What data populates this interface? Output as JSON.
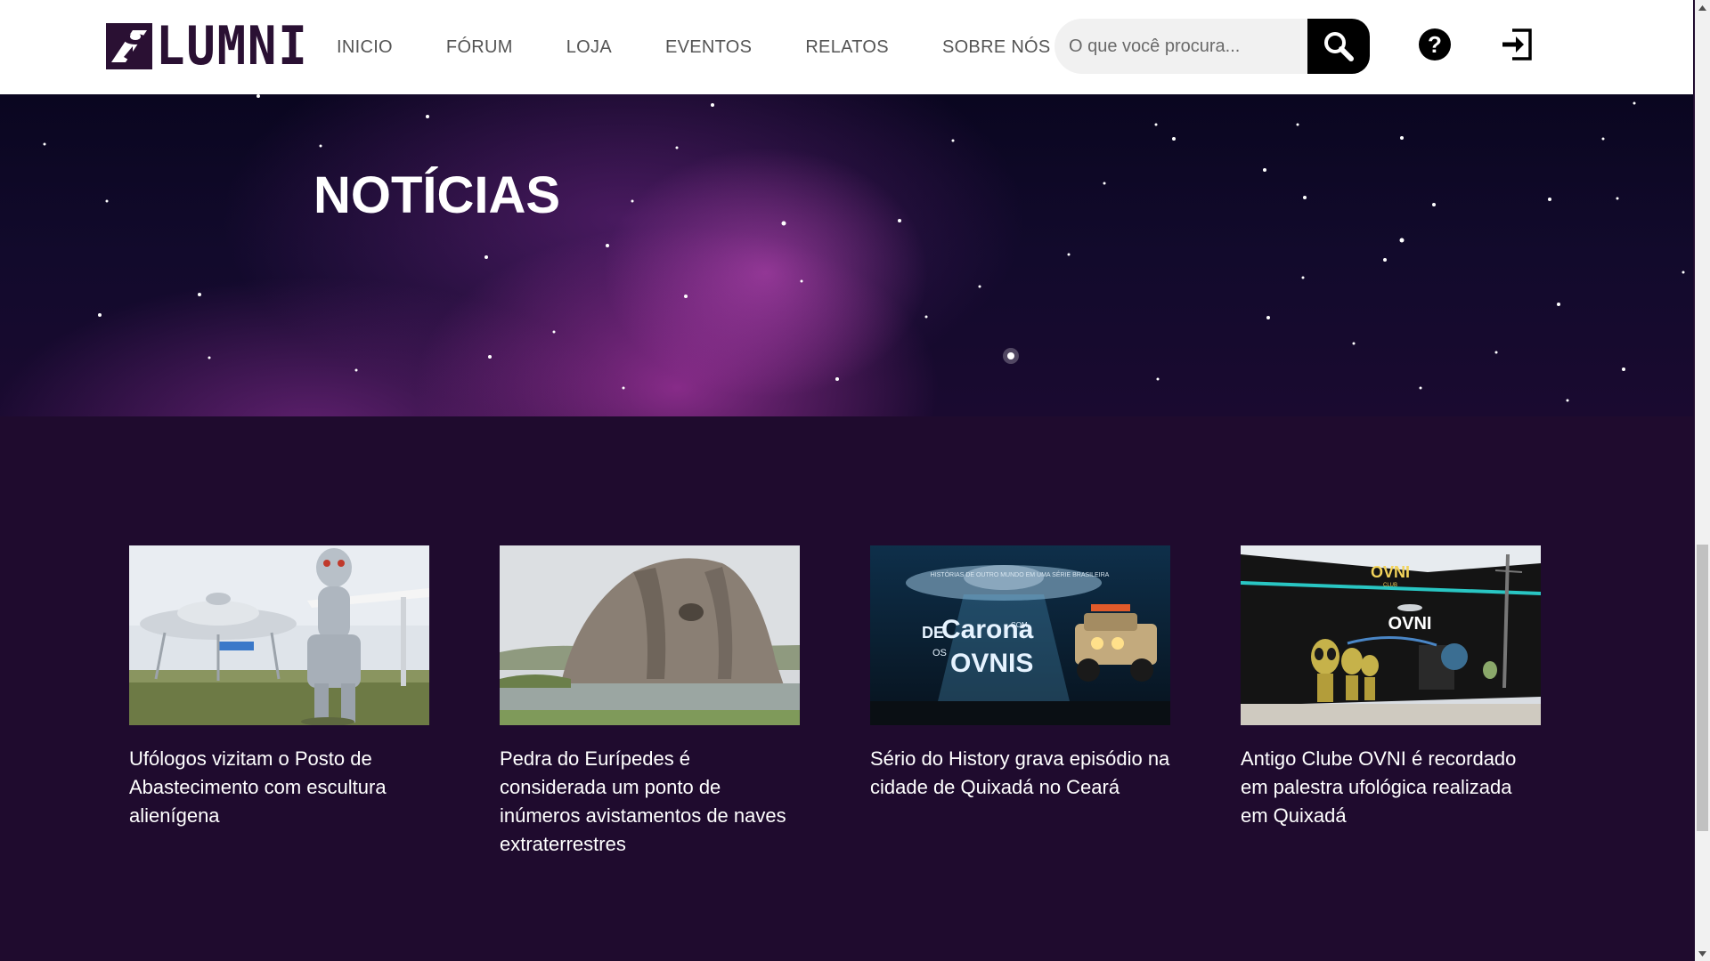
{
  "brand": {
    "name": "LUMNI",
    "colors": {
      "primary": "#2a1033",
      "accent": "#6b2a7a"
    }
  },
  "nav": {
    "items": [
      {
        "label": "INICIO"
      },
      {
        "label": "FÓRUM"
      },
      {
        "label": "LOJA"
      },
      {
        "label": "EVENTOS"
      },
      {
        "label": "RELATOS"
      },
      {
        "label": "SOBRE NÓS"
      }
    ]
  },
  "search": {
    "placeholder": "O que você procura...",
    "icon": "search-icon"
  },
  "header_actions": {
    "help_icon": "question-circle-icon",
    "login_icon": "sign-in-icon"
  },
  "hero": {
    "title": "NOTÍCIAS",
    "background": "purple-nebula-space"
  },
  "news": [
    {
      "title": "Ufólogos vizitam o Posto de Abastecimento com escultura alienígena",
      "image": "alien-statue-ufo-gas-station"
    },
    {
      "title": "Pedra do Eurípedes é considerada um ponto de inúmeros avistamentos de naves extraterrestres",
      "image": "rock-formation-lake"
    },
    {
      "title": "Sério do History grava episódio na cidade de Quixadá no Ceará",
      "image": "de-carona-com-os-ovnis-poster"
    },
    {
      "title": "Antigo Clube OVNI é recordado em palestra ufológica realizada em Quixadá",
      "image": "ovni-club-building"
    }
  ],
  "poster_text": {
    "tagline": "HISTÓRIAS DE OUTRO MUNDO EM UMA SÉRIE BRASILEIRA",
    "line1": "DE",
    "line2": "Carona",
    "line3": "COM",
    "line4": "OS",
    "line5": "OVNIS"
  },
  "club_sign": {
    "top": "OVNI",
    "sub": "CLUB",
    "main": "OVNI"
  }
}
